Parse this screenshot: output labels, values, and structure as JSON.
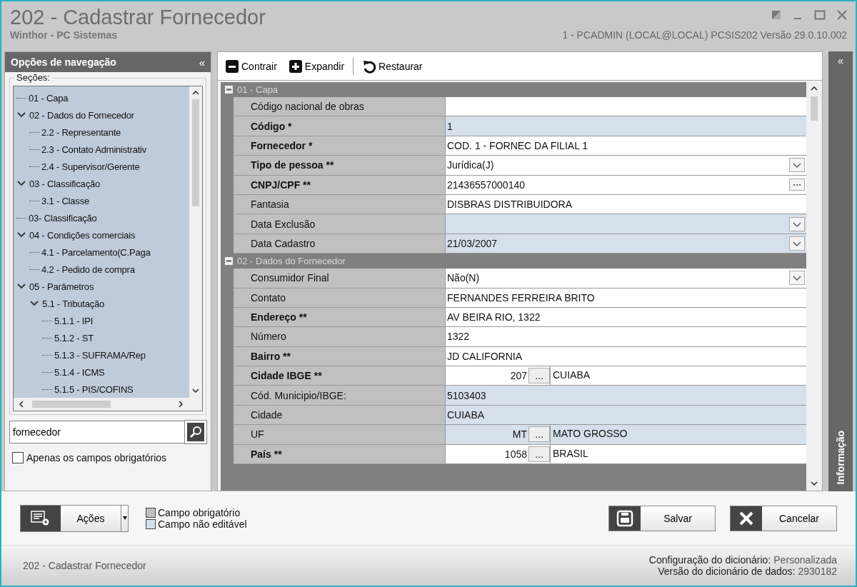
{
  "window": {
    "title": "202 - Cadastrar  Fornecedor",
    "subtitle": "Winthor - PC Sistemas",
    "info": "1 - PCADMIN (LOCAL@LOCAL)  PCSIS202  Versão  29.0.10.002"
  },
  "navigation": {
    "title": "Opções de navegação",
    "collapse": "«",
    "sections_label": "Seções:",
    "tree": [
      {
        "label": "01 - Capa"
      },
      {
        "label": "02 - Dados do Fornecedor",
        "expanded": true,
        "children": [
          {
            "label": "2.2 - Representante"
          },
          {
            "label": "2.3 - Contato Administrativ"
          },
          {
            "label": "2.4 - Supervisor/Gerente"
          }
        ]
      },
      {
        "label": "03 - Classificação",
        "expanded": true,
        "children": [
          {
            "label": "3.1 - Classe"
          }
        ]
      },
      {
        "label": "03- Classificação"
      },
      {
        "label": "04 - Condições comerciais",
        "expanded": true,
        "children": [
          {
            "label": "4.1 - Parcelamento(C.Paga"
          },
          {
            "label": "4.2 - Pedido de compra"
          }
        ]
      },
      {
        "label": "05 - Parâmetros",
        "expanded": true,
        "children": [
          {
            "label": "5.1 - Tributação",
            "expanded": true,
            "children": [
              {
                "label": "5.1.1 - IPI"
              },
              {
                "label": "5.1.2 - ST"
              },
              {
                "label": "5.1.3 - SUFRAMA/Rep"
              },
              {
                "label": "5.1.4 - ICMS"
              },
              {
                "label": "5.1.5 - PIS/COFINS"
              }
            ]
          }
        ]
      }
    ],
    "search": {
      "value": "fornecedor"
    },
    "only_required": {
      "label": "Apenas os campos obrigatórios",
      "checked": false
    }
  },
  "toolbar": [
    {
      "kind": "collapse",
      "label": "Contrair"
    },
    {
      "kind": "expand",
      "label": "Expandir"
    },
    {
      "kind": "restore",
      "label": "Restaurar"
    }
  ],
  "info_panel": {
    "collapse": "«",
    "label": "Informação"
  },
  "sections": [
    {
      "title": "01 - Capa",
      "expanded": true,
      "rows": [
        {
          "label": "Código nacional de obras",
          "required": false,
          "editable": true,
          "kind": "text"
        },
        {
          "label": "Código *",
          "required": true,
          "editable": false,
          "kind": "text",
          "value": "1"
        },
        {
          "label": "Fornecedor *",
          "required": true,
          "editable": true,
          "kind": "text",
          "value": "COD. 1 - FORNEC DA FILIAL 1"
        },
        {
          "label": "Tipo de pessoa **",
          "required": true,
          "editable": true,
          "kind": "combo",
          "value": "Jurídica(J)"
        },
        {
          "label": "CNPJ/CPF **",
          "required": true,
          "editable": true,
          "kind": "ellipsis",
          "value": "21436557000140"
        },
        {
          "label": "Fantasia",
          "required": false,
          "editable": true,
          "kind": "text",
          "value": "DISBRAS DISTRIBUIDORA"
        },
        {
          "label": "Data Exclusão",
          "required": false,
          "editable": false,
          "kind": "combo"
        },
        {
          "label": "Data Cadastro",
          "required": false,
          "editable": false,
          "kind": "combo",
          "value": "21/03/2007"
        }
      ]
    },
    {
      "title": "02 - Dados do Fornecedor",
      "expanded": true,
      "rows": [
        {
          "label": "Consumidor Final",
          "required": false,
          "editable": true,
          "kind": "combo",
          "value": "Não(N)"
        },
        {
          "label": "Contato",
          "required": false,
          "editable": true,
          "kind": "text",
          "value": "FERNANDES FERREIRA BRITO"
        },
        {
          "label": "Endereço **",
          "required": true,
          "editable": true,
          "kind": "text",
          "value": "AV BEIRA RIO, 1322"
        },
        {
          "label": "Número",
          "required": false,
          "editable": true,
          "kind": "text",
          "value": "1322"
        },
        {
          "label": "Bairro **",
          "required": true,
          "editable": true,
          "kind": "text",
          "value": "JD CALIFORNIA"
        },
        {
          "label": "Cidade IBGE **",
          "required": true,
          "editable": true,
          "kind": "lookup",
          "code": "207",
          "button": "...",
          "value": "CUIABA"
        },
        {
          "label": "Cód. Municipio/IBGE:",
          "required": false,
          "editable": false,
          "kind": "text",
          "value": "5103403"
        },
        {
          "label": "Cidade",
          "required": false,
          "editable": false,
          "kind": "text",
          "value": "CUIABA"
        },
        {
          "label": "UF",
          "required": false,
          "editable": false,
          "kind": "lookup",
          "code": "MT",
          "button": "...",
          "value": "MATO GROSSO"
        },
        {
          "label": "País **",
          "required": true,
          "editable": true,
          "kind": "lookup",
          "code": "1058",
          "button": "...",
          "value": "BRASIL"
        }
      ]
    }
  ],
  "actions_button": {
    "label": "Ações"
  },
  "legend": [
    {
      "label": "Campo obrigatório",
      "color": "#c0c0c0"
    },
    {
      "label": "Campo não editável",
      "color": "#d6e0eb"
    }
  ],
  "buttons": [
    {
      "kind": "save",
      "label": "Salvar"
    },
    {
      "kind": "cancel",
      "label": "Cancelar"
    }
  ],
  "status_bar": {
    "left": "202 - Cadastrar  Fornecedor",
    "config_label": "Configuração do dicionário:",
    "config_value": "Personalizada",
    "version_label": "Versão do dicionário de dados:",
    "version_value": "2930182"
  }
}
